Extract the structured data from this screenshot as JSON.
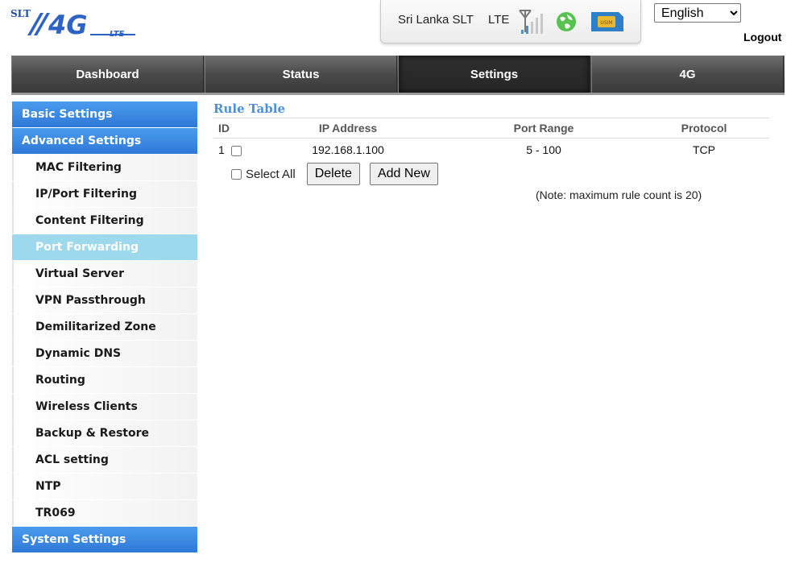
{
  "header": {
    "brand": "SLT",
    "logo_text": "4G",
    "logo_sub": "LTE",
    "carrier": "Sri Lanka SLT",
    "network_type": "LTE",
    "usim_label": "USIM",
    "language": "English",
    "language_options": [
      "English"
    ],
    "logout_label": "Logout"
  },
  "nav": {
    "tabs": [
      {
        "label": "Dashboard",
        "active": false
      },
      {
        "label": "Status",
        "active": false
      },
      {
        "label": "Settings",
        "active": true
      },
      {
        "label": "4G",
        "active": false
      }
    ]
  },
  "sidebar": {
    "basic": "Basic Settings",
    "advanced": "Advanced Settings",
    "items": [
      "MAC Filtering",
      "IP/Port Filtering",
      "Content Filtering",
      "Port Forwarding",
      "Virtual Server",
      "VPN Passthrough",
      "Demilitarized Zone",
      "Dynamic DNS",
      "Routing",
      "Wireless Clients",
      "Backup & Restore",
      "ACL setting",
      "NTP",
      "TR069"
    ],
    "active_item": "Port Forwarding",
    "system": "System Settings"
  },
  "main": {
    "title": "Rule Table",
    "columns": {
      "id": "ID",
      "ip": "IP Address",
      "port": "Port Range",
      "protocol": "Protocol"
    },
    "rows": [
      {
        "id": "1",
        "ip": "192.168.1.100",
        "port": "5 - 100",
        "protocol": "TCP"
      }
    ],
    "select_all_label": "Select All",
    "delete_label": "Delete",
    "add_label": "Add New",
    "note": "(Note: maximum rule count is 20)"
  },
  "colors": {
    "sidebar_head": "#3a88e2",
    "sidebar_active": "#9dd8ec",
    "title_blue": "#4a8fe0",
    "navbar": "#4a4a4a"
  }
}
